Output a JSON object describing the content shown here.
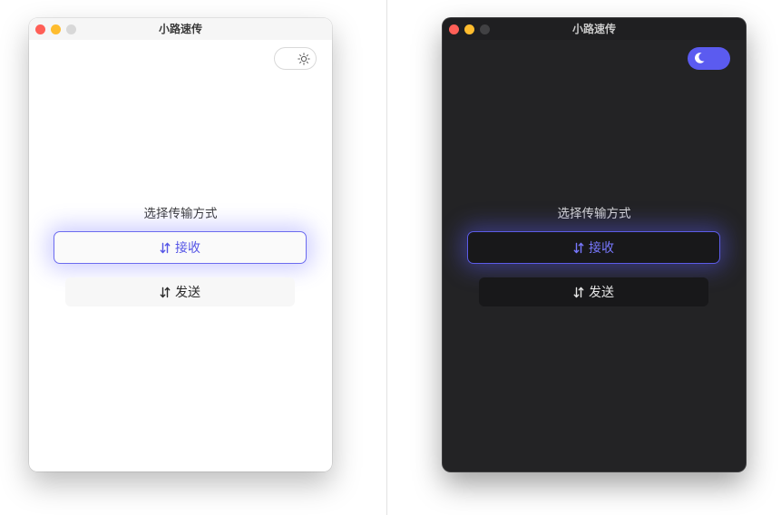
{
  "light_window": {
    "title": "小路速传",
    "theme_icon": "sun-icon",
    "prompt": "选择传输方式",
    "receive_label": "接收",
    "send_label": "发送"
  },
  "dark_window": {
    "title": "小路速传",
    "theme_icon": "moon-icon",
    "prompt": "选择传输方式",
    "receive_label": "接收",
    "send_label": "发送"
  },
  "colors": {
    "accent": "#5b5bf0",
    "light_bg": "#ffffff",
    "dark_bg": "#232325",
    "traffic_close": "#ff5f57",
    "traffic_minimize": "#febc2e"
  }
}
